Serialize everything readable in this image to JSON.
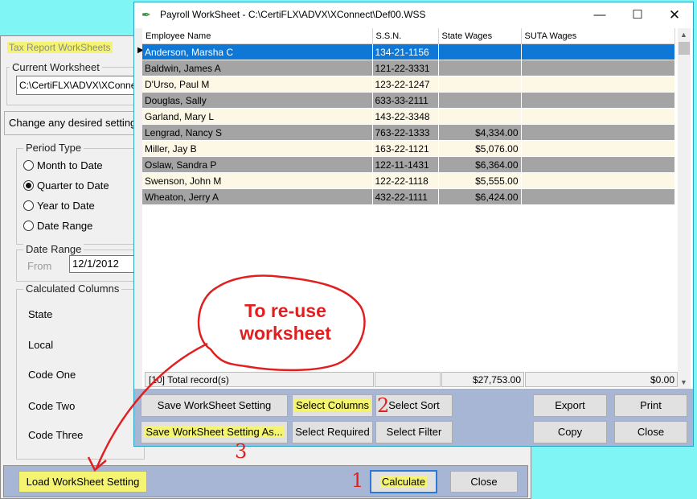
{
  "bg_window": {
    "title": "Tax Report WorkSheets",
    "current_worksheet_legend": "Current Worksheet",
    "current_worksheet_path": "C:\\CertiFLX\\ADVX\\XConnect",
    "change_bar": "Change any desired setting",
    "period_type_legend": "Period Type",
    "period_options": [
      {
        "label": "Month to Date",
        "selected": false
      },
      {
        "label": "Quarter to Date",
        "selected": true
      },
      {
        "label": "Year to Date",
        "selected": false
      },
      {
        "label": "Date Range",
        "selected": false
      }
    ],
    "date_range_legend": "Date Range",
    "from_label": "From",
    "from_value": "12/1/2012",
    "calculated_columns_legend": "Calculated Columns",
    "calculated_columns": [
      "State",
      "Local",
      "Code One",
      "Code Two",
      "Code Three"
    ],
    "load_button": "Load WorkSheet Setting",
    "calculate_button": "Calculate",
    "close_button": "Close"
  },
  "front_window": {
    "title": "Payroll WorkSheet - C:\\CertiFLX\\ADVX\\XConnect\\Def00.WSS",
    "columns": [
      "Employee Name",
      "S.S.N.",
      "State Wages",
      "SUTA Wages"
    ],
    "rows": [
      {
        "name": "Anderson, Marsha C",
        "ssn": "134-21-1156",
        "state_wages": "",
        "suta_wages": ""
      },
      {
        "name": "Baldwin, James A",
        "ssn": "121-22-3331",
        "state_wages": "",
        "suta_wages": ""
      },
      {
        "name": "D'Urso, Paul M",
        "ssn": "123-22-1247",
        "state_wages": "",
        "suta_wages": ""
      },
      {
        "name": "Douglas, Sally",
        "ssn": "633-33-2111",
        "state_wages": "",
        "suta_wages": ""
      },
      {
        "name": "Garland, Mary L",
        "ssn": "143-22-3348",
        "state_wages": "",
        "suta_wages": ""
      },
      {
        "name": "Lengrad, Nancy S",
        "ssn": "763-22-1333",
        "state_wages": "$4,334.00",
        "suta_wages": ""
      },
      {
        "name": "Miller, Jay B",
        "ssn": "163-22-1121",
        "state_wages": "$5,076.00",
        "suta_wages": ""
      },
      {
        "name": "Oslaw, Sandra P",
        "ssn": "122-11-1431",
        "state_wages": "$6,364.00",
        "suta_wages": ""
      },
      {
        "name": "Swenson, John M",
        "ssn": "122-22-1118",
        "state_wages": "$5,555.00",
        "suta_wages": ""
      },
      {
        "name": "Wheaton, Jerry A",
        "ssn": "432-22-1111",
        "state_wages": "$6,424.00",
        "suta_wages": ""
      }
    ],
    "totals": {
      "records": "[10] Total record(s)",
      "state_wages": "$27,753.00",
      "suta_wages": "$0.00"
    },
    "buttons": {
      "save_setting": "Save WorkSheet Setting",
      "select_columns": "Select Columns",
      "select_sort": "Select Sort",
      "export": "Export",
      "print": "Print",
      "save_setting_as": "Save WorkSheet Setting As...",
      "select_required": "Select Required",
      "select_filter": "Select Filter",
      "copy": "Copy",
      "close": "Close"
    }
  },
  "annotations": {
    "bubble_text_line1": "To re-use",
    "bubble_text_line2": "worksheet",
    "step1": "1",
    "step2": "2",
    "step3": "3"
  },
  "colors": {
    "desktop": "#7ff5f6",
    "highlight": "#f4f470",
    "selection": "#0f78d7",
    "annotation": "#e02020",
    "button_bar": "#a7b6d5"
  }
}
